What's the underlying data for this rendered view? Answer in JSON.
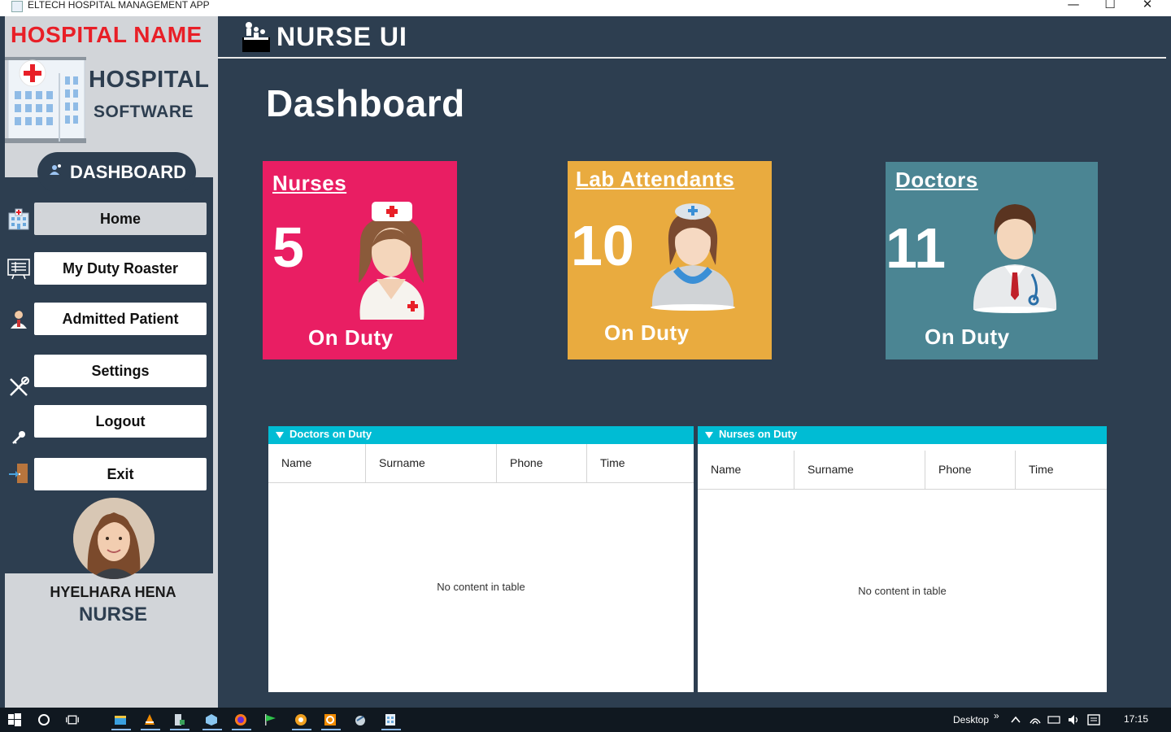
{
  "window": {
    "title": "ELTECH HOSPITAL MANAGEMENT APP",
    "minimize": "—",
    "maximize": "☐",
    "close": "✕"
  },
  "sidebar": {
    "hospital_name": "HOSPITAL NAME",
    "logo_line1": "HOSPITAL",
    "logo_line2": "SOFTWARE",
    "dashboard_label": "DASHBOARD",
    "nav": [
      {
        "label": "Home",
        "icon": "hospital-building-icon"
      },
      {
        "label": "My Duty Roaster",
        "icon": "roster-board-icon"
      },
      {
        "label": "Admitted Patient",
        "icon": "patient-icon"
      },
      {
        "label": "Settings",
        "icon": "tools-icon"
      },
      {
        "label": "Logout",
        "icon": "key-icon"
      },
      {
        "label": "Exit",
        "icon": "exit-door-icon"
      }
    ],
    "user_name": "HYELHARA HENA",
    "user_role": "NURSE"
  },
  "header": {
    "title": "NURSE UI"
  },
  "main": {
    "page_title": "Dashboard",
    "cards": [
      {
        "title": "Nurses",
        "count": "5",
        "status": "On Duty",
        "color": "#e91e63",
        "icon": "nurse-icon"
      },
      {
        "title": "Lab Attendants",
        "count": "10",
        "status": "On Duty",
        "color": "#e9ab3f",
        "icon": "lab-attendant-icon"
      },
      {
        "title": "Doctors",
        "count": "11",
        "status": "On Duty",
        "color": "#4b8593",
        "icon": "doctor-icon"
      }
    ],
    "tables": [
      {
        "caption": "Doctors on Duty",
        "columns": [
          "Name",
          "Surname",
          "Phone",
          "Time"
        ],
        "empty_text": "No content in table"
      },
      {
        "caption": "Nurses on Duty",
        "columns": [
          "Name",
          "Surname",
          "Phone",
          "Time"
        ],
        "empty_text": "No content in table"
      }
    ]
  },
  "taskbar": {
    "desktop_label": "Desktop",
    "chevron": "»",
    "clock": "17:15"
  },
  "colors": {
    "sidebar_bg": "#d2d5d9",
    "main_bg": "#2d3e50",
    "table_header": "#00bcd4",
    "brand_red": "#e81f27"
  }
}
